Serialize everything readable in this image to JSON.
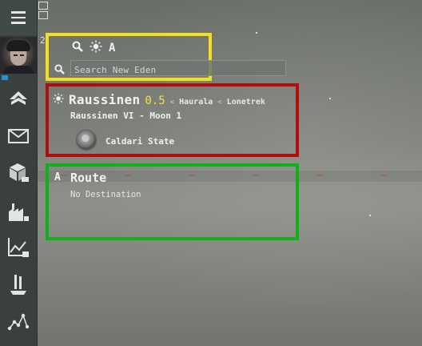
{
  "sidebar": {
    "menu_icon": "hamburger-menu-icon",
    "items": [
      {
        "name": "neocom-agency",
        "icon": "agency-icon"
      },
      {
        "name": "neocom-mail",
        "icon": "mail-icon"
      },
      {
        "name": "neocom-inventory",
        "icon": "inventory-icon"
      },
      {
        "name": "neocom-industry",
        "icon": "industry-icon"
      },
      {
        "name": "neocom-market",
        "icon": "market-icon"
      },
      {
        "name": "neocom-fitting",
        "icon": "fitting-icon"
      },
      {
        "name": "neocom-map",
        "icon": "star-map-icon"
      }
    ]
  },
  "counter": "2",
  "search": {
    "placeholder": "Search New Eden",
    "route_letter": "A"
  },
  "location": {
    "system": "Raussinen",
    "security": "0.5",
    "constellation": "Haurala",
    "region": "Lonetrek",
    "separator": "<",
    "station": "Raussinen VI - Moon 1",
    "faction": "Caldari State"
  },
  "route": {
    "letter": "A",
    "title": "Route",
    "subtitle": "No Destination"
  },
  "colors": {
    "security_color": "#f3e236",
    "yellow_box": "#f4e01a",
    "red_box": "#b00d0d",
    "green_box": "#0fb01a"
  }
}
